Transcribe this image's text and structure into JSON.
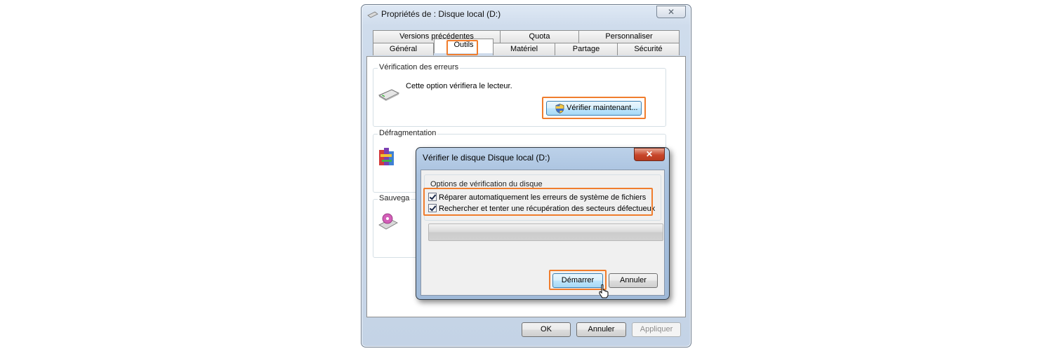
{
  "main_window": {
    "title": "Propriétés de : Disque local (D:)",
    "close_label": "✕",
    "tabs_row1": [
      "Versions précédentes",
      "Quota",
      "Personnaliser"
    ],
    "tabs_row2": [
      "Général",
      "Outils",
      "Matériel",
      "Partage",
      "Sécurité"
    ],
    "active_tab": "Outils",
    "error_check": {
      "group_label": "Vérification des erreurs",
      "description": "Cette option vérifiera le lecteur.",
      "button_label": "Vérifier maintenant..."
    },
    "defrag": {
      "group_label": "Défragmentation"
    },
    "backup": {
      "group_label": "Sauvega"
    },
    "buttons": {
      "ok": "OK",
      "cancel": "Annuler",
      "apply": "Appliquer"
    }
  },
  "check_dialog": {
    "title": "Vérifier le disque Disque local (D:)",
    "close_label": "✕",
    "group_label": "Options de vérification du disque",
    "options": [
      {
        "label": "Réparer automatiquement les erreurs de système de fichiers",
        "checked": true
      },
      {
        "label": "Rechercher et tenter une récupération des secteurs défectueux",
        "checked": true
      }
    ],
    "buttons": {
      "start": "Démarrer",
      "cancel": "Annuler"
    }
  },
  "colors": {
    "highlight": "#f07d2d",
    "title_bar": "#c4d3e6",
    "close_red": "#c7452a"
  },
  "icons": [
    "drive-icon",
    "defrag-icon",
    "backup-icon",
    "shield-icon",
    "cursor-icon"
  ]
}
